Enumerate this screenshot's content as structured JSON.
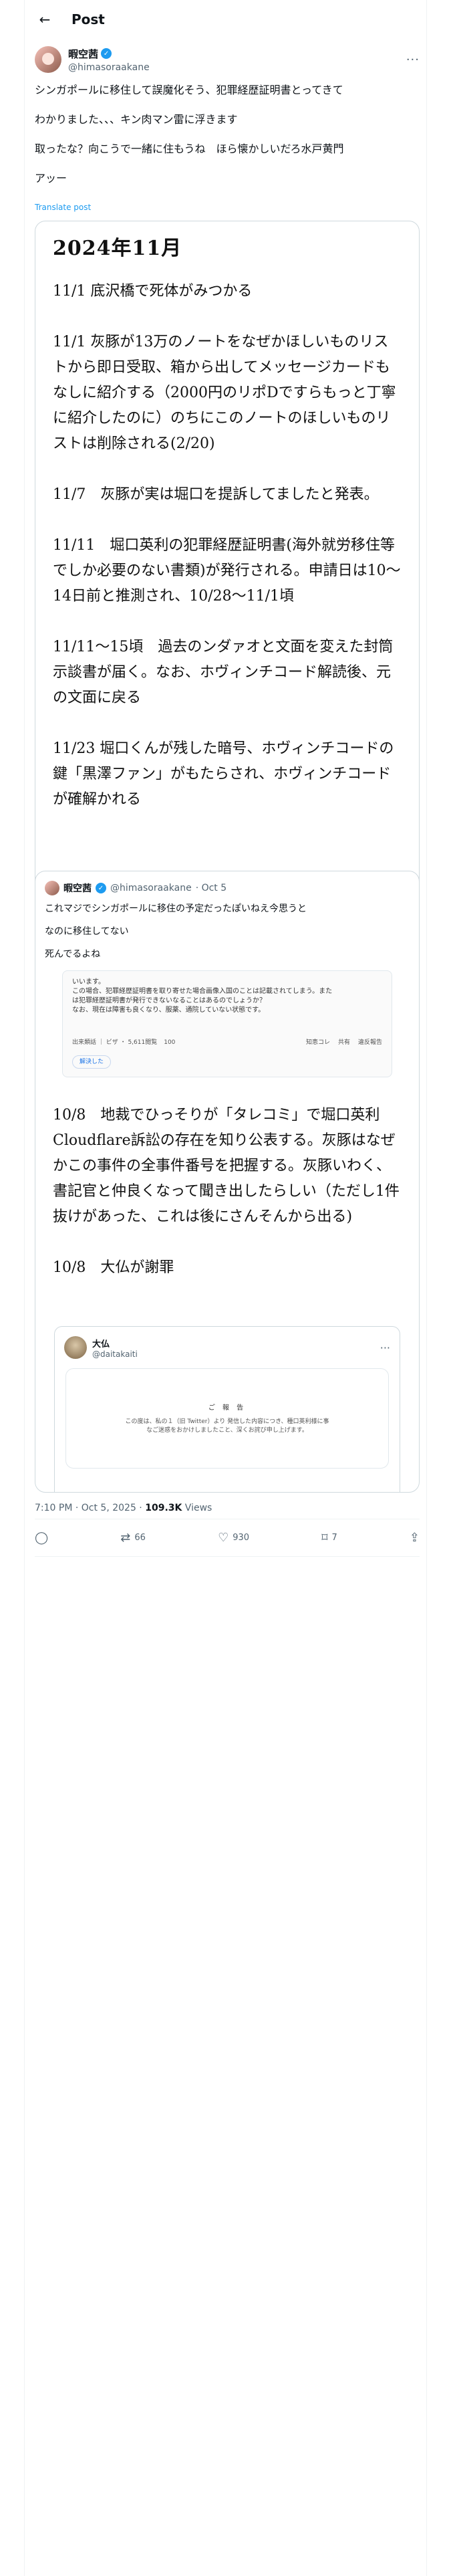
{
  "header": {
    "back_icon": "arrow-left-icon",
    "title": "Post"
  },
  "author": {
    "name": "暇空茜",
    "handle": "@himasoraakane",
    "verified_icon": "verified-badge-icon",
    "more_icon": "more-horizontal-icon"
  },
  "post": {
    "lines": [
      "シンガポールに移住して誤魔化そう、犯罪経歴証明書とってきて",
      "わかりました、、、キン肉マン雷に浮きます",
      "取ったな？向こうで一緒に住もうね　ほら懐かしいだろ水戸黄門",
      "アッー"
    ],
    "translate_label": "Translate post"
  },
  "image_card": {
    "heading": "2024年11月",
    "entries": [
      "11/1 底沢橋で死体がみつかる",
      "11/1 灰豚が13万のノートをなぜかほしいものリストから即日受取、箱から出してメッセージカードもなしに紹介する（2000円のリポDですらもっと丁寧に紹介したのに）のちにこのノートのほしいものリストは削除される(2/20)",
      "11/7　灰豚が実は堀口を提訴してましたと発表。",
      "11/11　堀口英利の犯罪経歴証明書(海外就労移住等でしか必要のない書類)が発行される。申請日は10～14日前と推測され、10/28～11/1頃",
      "11/11～15頃　過去のンダァオと文面を変えた封筒示談書が届く。なお、ホヴィンチコード解読後、元の文面に戻る",
      "11/23 堀口くんが残した暗号、ホヴィンチコードの鍵「黒澤ファン」がもたらされ、ホヴィンチコードが確解かれる"
    ]
  },
  "quote": {
    "name": "暇空茜",
    "handle": "@himasoraakane",
    "date": "· Oct 5",
    "lines": [
      "これマジでシンガポールに移住の予定だったぽいねえ今思うと",
      "なのに移住してない",
      "死んでるよね"
    ],
    "screenshot": {
      "lines": [
        "いいます。",
        "この場合、犯罪経歴証明書を取り寄せた場合画像入国のことは記載されてしまう。また",
        "は犯罪経歴証明書が発行できないなることはあるのでしょうか？",
        "なお、現在は障害も良くなり、服薬、通院していない状態です。"
      ],
      "category": "出来類話 ｜ ビザ ・ 5,611閲覧",
      "badge": "100",
      "actions": [
        "知恵コレ",
        "共有",
        "違反報告"
      ],
      "resolved_label": "解決した"
    },
    "entries": [
      "10/8　地裁でひっそりが「タレコミ」で堀口英利Cloudflare訴訟の存在を知り公表する。灰豚はなぜかこの事件の全事件番号を把握する。灰豚いわく、書記官と仲良くなって聞き出したらしい（ただし1件抜けがあった、これは後にさんそんから出る)",
      "10/8　大仏が謝罪"
    ],
    "embed": {
      "name": "大仏",
      "handle": "@daitakaiti",
      "notice_title": "ご 報 告",
      "notice_lines": [
        "この度は、私の１（旧 Twitter）より 発信した内容につき、種口英利様に事",
        "なご迷惑をおかけしましたこと、深くお詫び申し上げます。"
      ]
    }
  },
  "meta": {
    "time": "7:10 PM · Oct 5, 2025 · ",
    "views": "109.3K",
    "views_label": " Views"
  },
  "actions": {
    "reply_icon": "reply-icon",
    "repost_icon": "repost-icon",
    "repost_count": "66",
    "like_icon": "heart-icon",
    "like_count": "930",
    "bookmark_icon": "bookmark-icon",
    "bookmark_count": "7",
    "share_icon": "share-icon"
  }
}
